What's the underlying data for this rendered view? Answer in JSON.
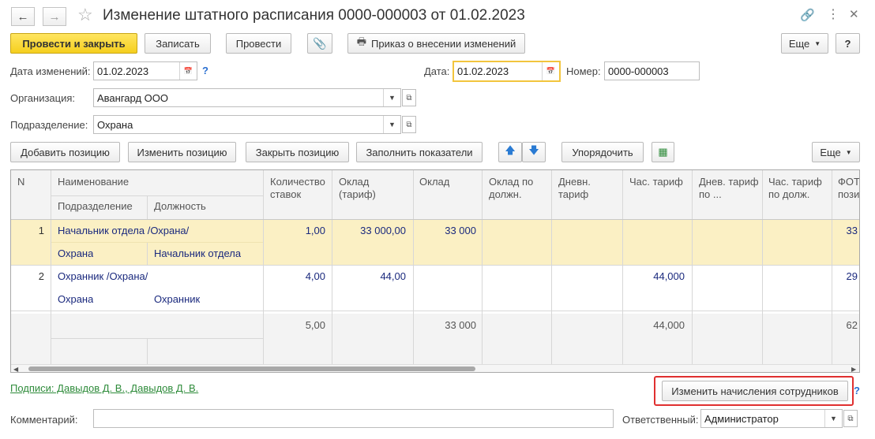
{
  "window": {
    "title": "Изменение штатного расписания 0000-000003 от 01.02.2023"
  },
  "toolbar": {
    "post_close": "Провести и закрыть",
    "save": "Записать",
    "post": "Провести",
    "order": "Приказ о внесении изменений",
    "more": "Еще",
    "help": "?"
  },
  "form": {
    "change_date_label": "Дата изменений:",
    "change_date": "01.02.2023",
    "date_label": "Дата:",
    "date": "01.02.2023",
    "number_label": "Номер:",
    "number": "0000-000003",
    "org_label": "Организация:",
    "org": "Авангард ООО",
    "dept_label": "Подразделение:",
    "dept": "Охрана",
    "help": "?"
  },
  "table_toolbar": {
    "add": "Добавить позицию",
    "change": "Изменить позицию",
    "close": "Закрыть позицию",
    "fill": "Заполнить показатели",
    "sort": "Упорядочить",
    "more": "Еще"
  },
  "table": {
    "headers": {
      "n": "N",
      "name": "Наименование",
      "subdivision": "Подразделение",
      "position": "Должность",
      "qty": "Количество ставок",
      "salary_tariff": "Оклад (тариф)",
      "salary": "Оклад",
      "salary_by_pos": "Оклад по должн.",
      "daily_tariff": "Дневн. тариф",
      "hourly_tariff": "Час. тариф",
      "daily_tariff_by": "Днев. тариф по ...",
      "hourly_tariff_by": "Час. тариф по долж.",
      "fot": "ФОТ пози"
    },
    "rows": [
      {
        "n": "1",
        "name": "Начальник отдела /Охрана/",
        "subdivision": "Охрана",
        "position": "Начальник отдела",
        "qty": "1,00",
        "salary_tariff": "33 000,00",
        "salary": "33 000",
        "hourly_tariff": "",
        "fot": "33"
      },
      {
        "n": "2",
        "name": "Охранник /Охрана/",
        "subdivision": "Охрана",
        "position": "Охранник",
        "qty": "4,00",
        "salary_tariff": "44,00",
        "salary": "",
        "hourly_tariff": "44,000",
        "fot": "29"
      }
    ],
    "totals": {
      "qty": "5,00",
      "salary": "33 000",
      "hourly_tariff": "44,000",
      "fot": "62"
    }
  },
  "footer": {
    "signatures": "Подписи: Давыдов Д. В., Давыдов Д. В.",
    "change_accruals": "Изменить начисления сотрудников",
    "help": "?",
    "comment_label": "Комментарий:",
    "comment": "",
    "responsible_label": "Ответственный:",
    "responsible": "Администратор"
  }
}
